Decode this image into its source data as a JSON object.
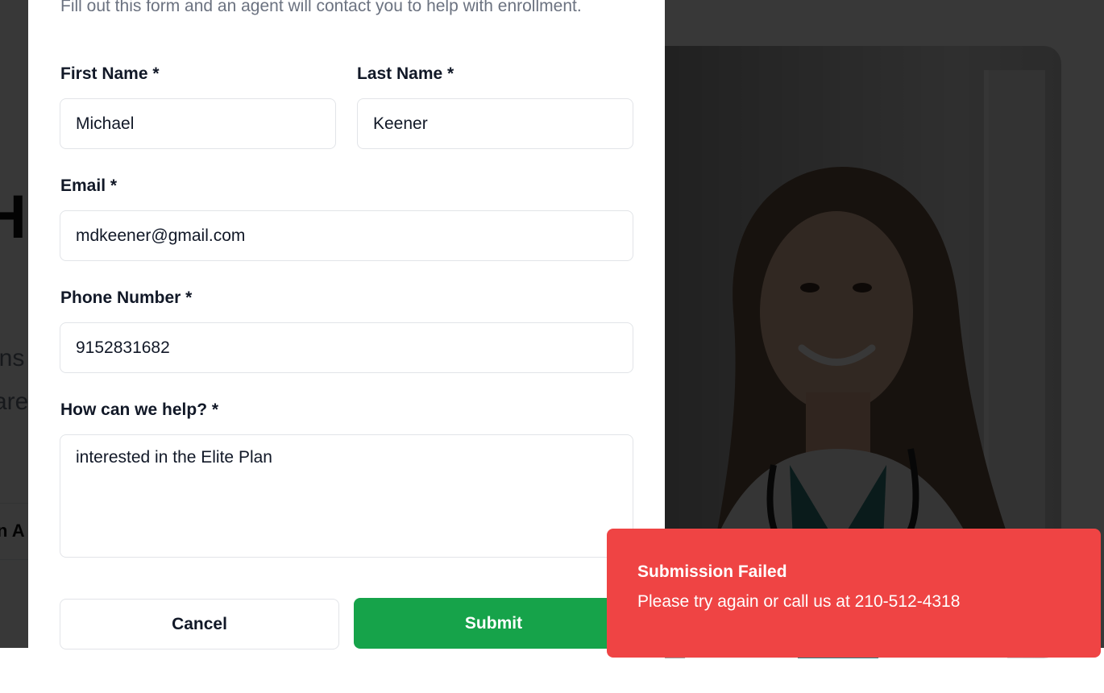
{
  "background": {
    "heading_fragment": "H",
    "text_fragment_1": "ins",
    "text_fragment_2": "are",
    "nav_fragment": "n A"
  },
  "form": {
    "subtitle": "Fill out this form and an agent will contact you to help with enrollment.",
    "first_name": {
      "label": "First Name *",
      "value": "Michael"
    },
    "last_name": {
      "label": "Last Name *",
      "value": "Keener"
    },
    "email": {
      "label": "Email *",
      "value": "mdkeener@gmail.com"
    },
    "phone": {
      "label": "Phone Number *",
      "value": "9152831682"
    },
    "help": {
      "label": "How can we help? *",
      "value": "interested in the Elite Plan"
    },
    "cancel_label": "Cancel",
    "submit_label": "Submit"
  },
  "toast": {
    "title": "Submission Failed",
    "description": "Please try again or call us at 210-512-4318",
    "color": "#ef4444"
  },
  "colors": {
    "submit": "#16a34a"
  }
}
